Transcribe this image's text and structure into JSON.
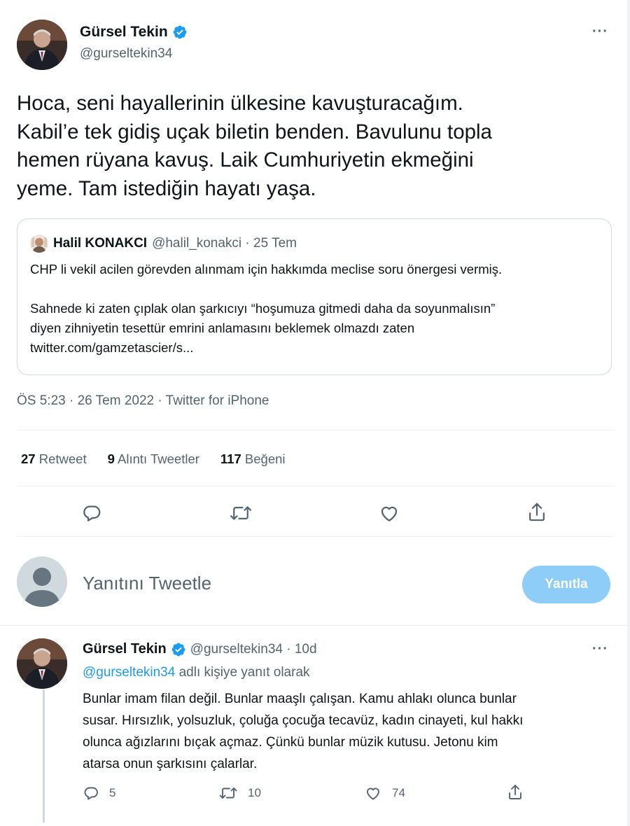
{
  "colors": {
    "text_primary": "#0f1419",
    "text_secondary": "#536471",
    "link": "#1d9bf0",
    "verified_badge": "#1d9bf0",
    "reply_button_bg": "#8ecdf8",
    "border": "#cfd9de"
  },
  "tweet": {
    "author_name": "Gürsel Tekin",
    "author_handle": "@gurseltekin34",
    "more_label": "···",
    "text_lines": [
      "Hoca, seni hayallerinin ülkesine kavuşturacağım.",
      "Kabil’e tek gidiş uçak biletin benden. Bavulunu topla",
      "hemen rüyana kavuş. Laik Cumhuriyetin ekmeğini",
      "yeme. Tam istediğin hayatı yaşa."
    ],
    "quote": {
      "author_name": "Halil KONAKCI",
      "author_handle_date": "@halil_konakci · 25 Tem",
      "text_lines": [
        "CHP li vekil acilen görevden alınmam için hakkımda meclise soru önergesi vermiş.",
        "",
        "Sahnede ki zaten çıplak olan şarkıcıyı “hoşumuza gitmedi daha da soyunmalısın”",
        "diyen zihniyetin tesettür emrini anlamasını beklemek olmazdı zaten",
        "twitter.com/gamzetascier/s..."
      ]
    },
    "timestamp": "ÖS 5:23 · 26 Tem 2022 · Twitter for iPhone",
    "stats": {
      "retweets_count": "27",
      "retweets_label": "Retweet",
      "quotes_count": "9",
      "quotes_label": "Alıntı Tweetler",
      "likes_count": "117",
      "likes_label": "Beğeni"
    },
    "actions": [
      "reply-icon",
      "retweet-icon",
      "like-icon",
      "share-icon"
    ]
  },
  "compose": {
    "placeholder": "Yanıtını Tweetle",
    "button_label": "Yanıtla"
  },
  "reply": {
    "author_name": "Gürsel Tekin",
    "handle_time": "@gurseltekin34 · 10d",
    "more_label": "···",
    "replying_to_handle": "@gurseltekin34",
    "replying_to_suffix": " adlı kişiye yanıt olarak",
    "text_lines": [
      "Bunlar imam filan değil. Bunlar maaşlı çalışan. Kamu ahlakı olunca bunlar",
      "susar. Hırsızlık, yolsuzluk, çoluğa çocuğa tecavüz, kadın cinayeti, kul hakkı",
      "olunca ağızlarını bıçak açmaz. Çünkü bunlar müzik kutusu. Jetonu kim",
      "atarsa onun şarkısını çalarlar."
    ],
    "reply_count": "5",
    "retweet_count": "10",
    "like_count": "74"
  }
}
